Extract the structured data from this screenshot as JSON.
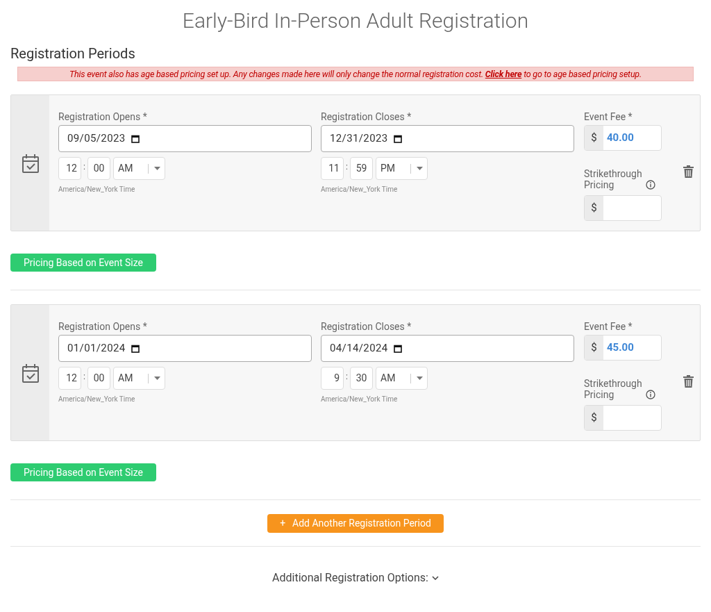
{
  "title": "Early-Bird In-Person Adult Registration",
  "section_heading": "Registration Periods",
  "alert": {
    "before": "This event also has age based pricing set up. Any changes made here will only change the normal registration cost.",
    "link": "Click here",
    "after": "to go to age based pricing setup."
  },
  "periods": [
    {
      "opens": {
        "label": "Registration Opens *",
        "date": "09/05/2023",
        "hour": "12",
        "separator": ":",
        "minute": "00",
        "ampm": "AM",
        "timezone": "America/New_York Time"
      },
      "closes": {
        "label": "Registration Closes *",
        "date": "12/31/2023",
        "hour": "11",
        "separator": ":",
        "minute": "59",
        "ampm": "PM",
        "timezone": "America/New_York Time"
      },
      "fee": {
        "label": "Event Fee *",
        "currency": "$",
        "value": "40.00"
      },
      "strikethrough": {
        "label": "Strikethrough Pricing",
        "currency": "$"
      },
      "size_button": "Pricing Based on Event Size"
    },
    {
      "opens": {
        "label": "Registration Opens *",
        "date": "01/01/2024",
        "hour": "12",
        "separator": ":",
        "minute": "00",
        "ampm": "AM",
        "timezone": "America/New_York Time"
      },
      "closes": {
        "label": "Registration Closes *",
        "date": "04/14/2024",
        "hour": "9",
        "separator": ":",
        "minute": "30",
        "ampm": "AM",
        "timezone": "America/New_York Time"
      },
      "fee": {
        "label": "Event Fee *",
        "currency": "$",
        "value": "45.00"
      },
      "strikethrough": {
        "label": "Strikethrough Pricing",
        "currency": "$"
      },
      "size_button": "Pricing Based on Event Size"
    }
  ],
  "add_button": {
    "icon": "+",
    "label": "Add Another Registration Period"
  },
  "additional_options": "Additional Registration Options:"
}
